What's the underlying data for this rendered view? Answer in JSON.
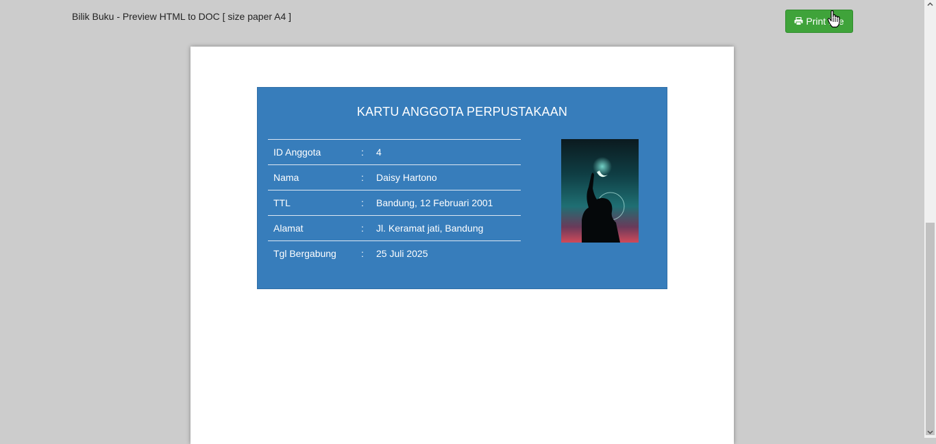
{
  "header": {
    "title": "Bilik Buku - Preview HTML to DOC [ size paper A4 ]",
    "print_label": "Print File",
    "print_icon": "printer-icon"
  },
  "card": {
    "title": "KARTU ANGGOTA PERPUSTAKAAN",
    "separator": ":",
    "rows": [
      {
        "label": "ID Anggota",
        "value": "4"
      },
      {
        "label": "Nama",
        "value": "Daisy Hartono"
      },
      {
        "label": "TTL",
        "value": "Bandung, 12 Februari 2001"
      },
      {
        "label": "Alamat",
        "value": "Jl. Keramat jati, Bandung"
      },
      {
        "label": "Tgl Bergabung",
        "value": "25 Juli 2025"
      }
    ]
  },
  "colors": {
    "page_bg": "#cccccc",
    "card_bg": "#377dbb",
    "button_bg": "#3fa33a"
  }
}
